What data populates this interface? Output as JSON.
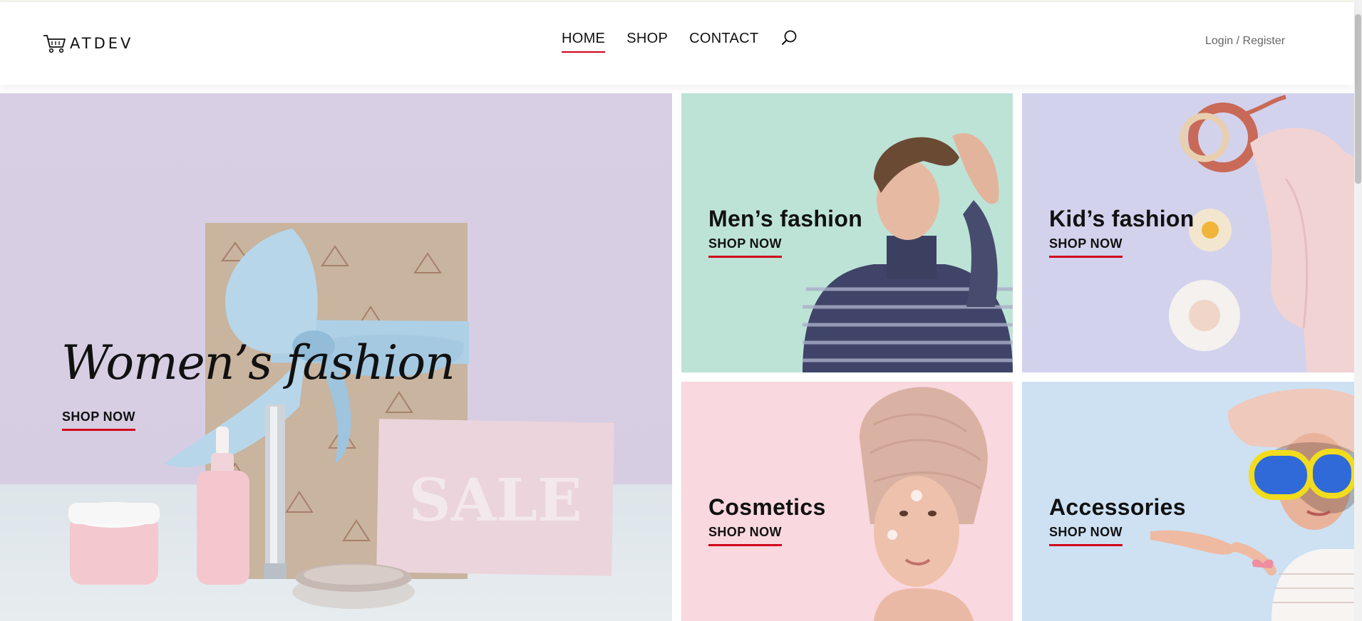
{
  "brand": {
    "name": "ATDEV",
    "icon": "shopping-cart-icon"
  },
  "nav": {
    "items": [
      {
        "label": "HOME",
        "active": true
      },
      {
        "label": "SHOP",
        "active": false
      },
      {
        "label": "CONTACT",
        "active": false
      }
    ],
    "search_icon": "search-icon"
  },
  "auth": {
    "login": "Login",
    "separator": "/",
    "register": "Register"
  },
  "hero": {
    "title": "Women’s fashion",
    "cta": "SHOP NOW",
    "sale_text": "SALE"
  },
  "categories": [
    {
      "title": "Men’s fashion",
      "cta": "SHOP NOW",
      "bg": "#bde3d7"
    },
    {
      "title": "Kid’s fashion",
      "cta": "SHOP NOW",
      "bg": "#d3d2ec"
    },
    {
      "title": "Cosmetics",
      "cta": "SHOP NOW",
      "bg": "#f9d8df"
    },
    {
      "title": "Accessories",
      "cta": "SHOP NOW",
      "bg": "#cde1f3"
    }
  ],
  "colors": {
    "accent": "#d0021b",
    "text": "#111111",
    "muted": "#666666"
  }
}
